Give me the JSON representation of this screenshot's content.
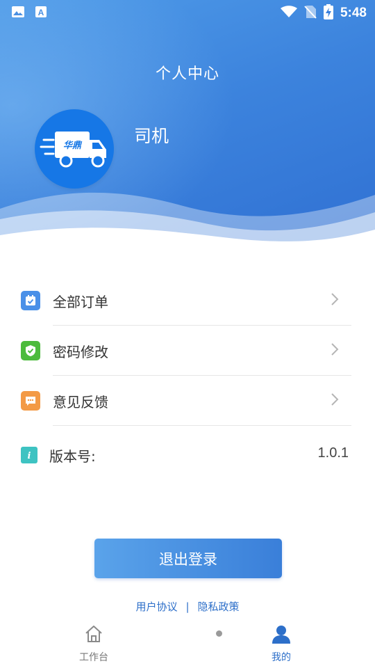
{
  "status_bar": {
    "time": "5:48",
    "left_icons": [
      "gallery-icon",
      "font-icon"
    ],
    "right_icons": [
      "wifi-icon",
      "no-sim-icon",
      "battery-charging-icon"
    ]
  },
  "header": {
    "title": "个人中心",
    "username": "司机",
    "avatar_text": "华鼎",
    "accent_color": "#3a80dc"
  },
  "menu": {
    "items": [
      {
        "label": "全部订单",
        "icon": "calendar-check-icon",
        "icon_color": "#4a90e8"
      },
      {
        "label": "密码修改",
        "icon": "shield-check-icon",
        "icon_color": "#4cbb3c"
      },
      {
        "label": "意见反馈",
        "icon": "chat-bubble-icon",
        "icon_color": "#f39a45"
      }
    ],
    "version": {
      "label": "版本号:",
      "value": "1.0.1",
      "icon": "info-icon",
      "icon_color": "#3ec3c2"
    }
  },
  "actions": {
    "logout_label": "退出登录"
  },
  "legal": {
    "user_agreement": "用户协议",
    "separator": "|",
    "privacy_policy": "隐私政策"
  },
  "tabbar": {
    "tabs": [
      {
        "label": "工作台",
        "icon": "home-icon",
        "active": false
      },
      {
        "label": "我的",
        "icon": "user-icon",
        "active": true
      }
    ]
  }
}
